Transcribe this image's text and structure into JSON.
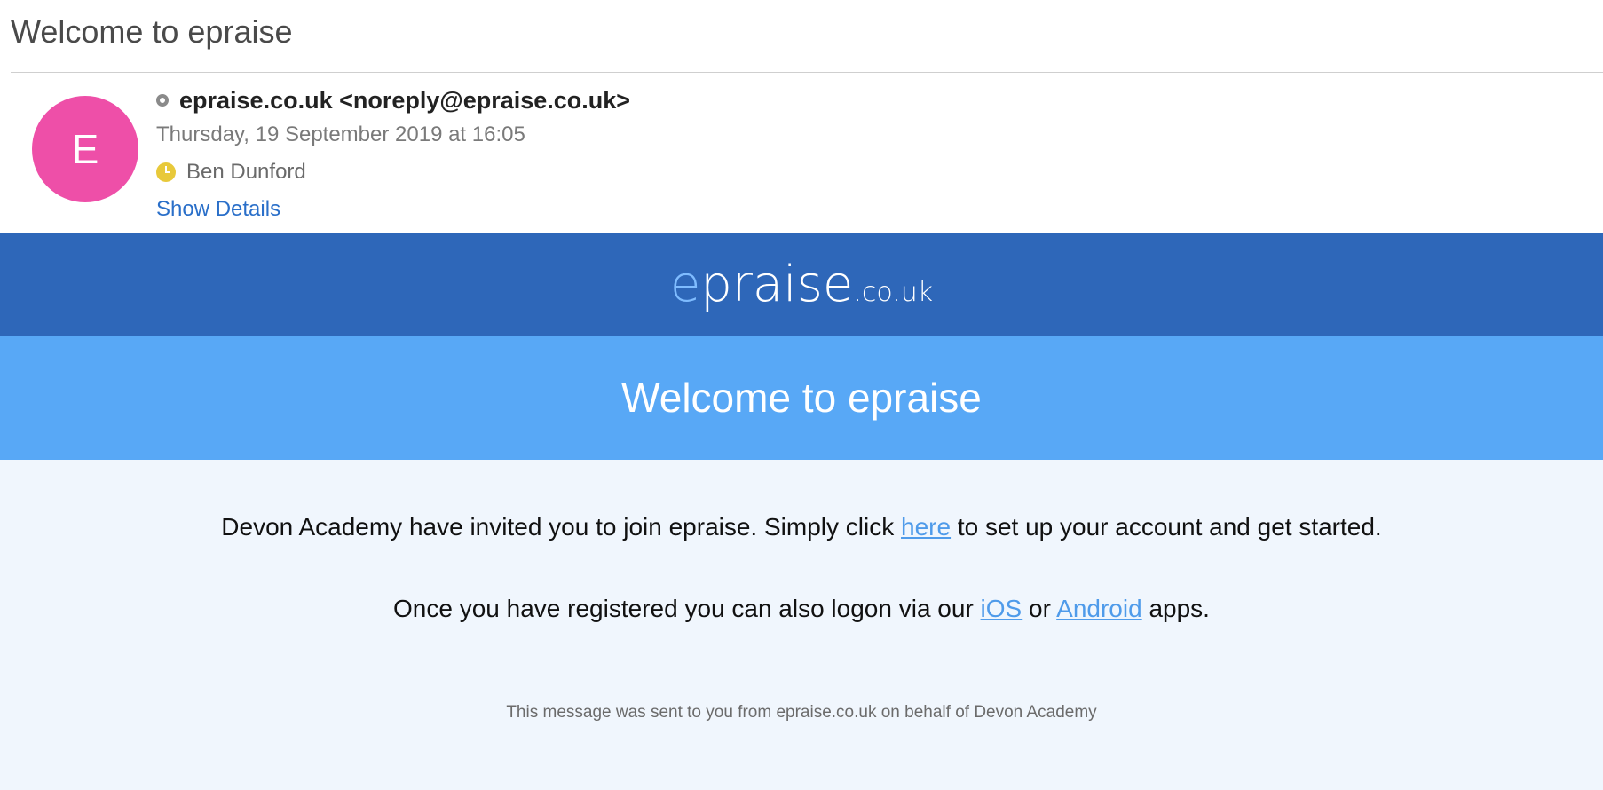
{
  "email": {
    "subject": "Welcome to epraise",
    "avatar_letter": "E",
    "from": "epraise.co.uk <noreply@epraise.co.uk>",
    "date": "Thursday, 19 September 2019 at 16:05",
    "to": "Ben Dunford",
    "show_details_label": "Show Details"
  },
  "body": {
    "logo": {
      "e": "e",
      "praise": "praise",
      "tld": ".co.uk"
    },
    "welcome_heading": "Welcome to epraise",
    "paragraph1": {
      "before": "Devon Academy have invited you to join epraise. Simply click ",
      "link": "here",
      "after": " to set up your account and get started."
    },
    "paragraph2": {
      "before": "Once you have registered you can also logon via our ",
      "ios_link": "iOS",
      "middle": " or ",
      "android_link": "Android",
      "after": " apps."
    },
    "footer_note": "This message was sent to you from epraise.co.uk on behalf of Devon Academy"
  },
  "colors": {
    "avatar": "#ee4fa8",
    "status_clock": "#e8c93a",
    "brand_dark": "#2e67b9",
    "brand_light": "#58a8f6",
    "content_bg": "#f0f6fd",
    "link": "#4f9bea",
    "logo_accent": "#7fbcff"
  },
  "icons": {
    "status": "status-ring-icon",
    "recipient": "clock-icon"
  }
}
